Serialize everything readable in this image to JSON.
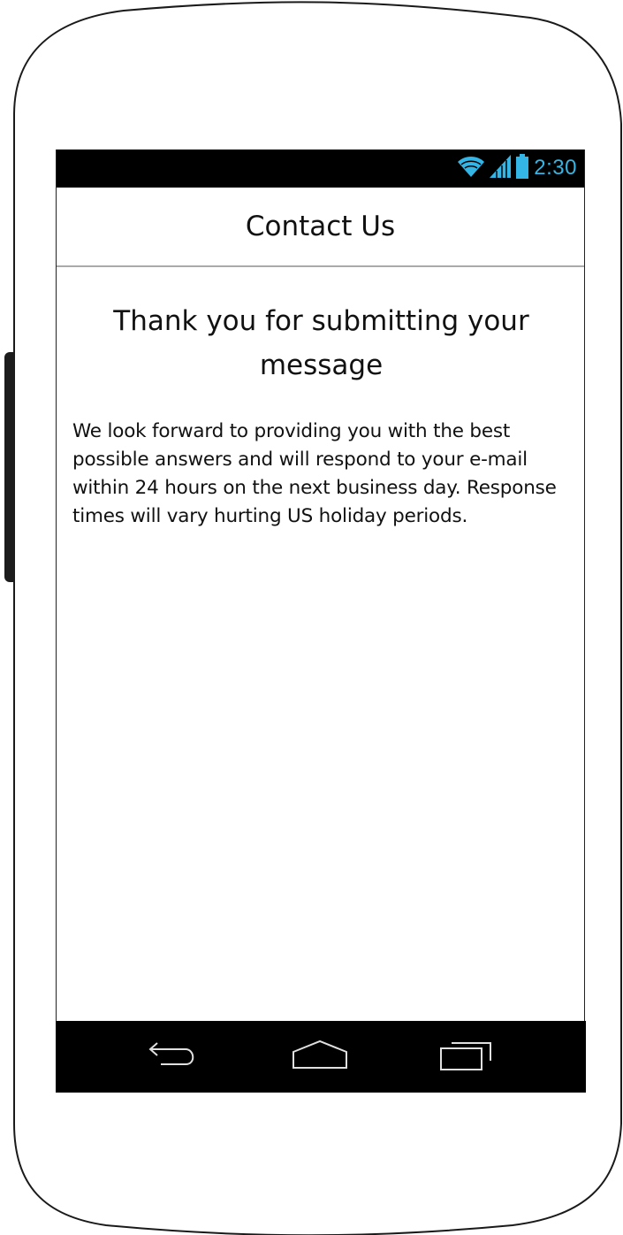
{
  "status_bar": {
    "time": "2:30",
    "icons": [
      "wifi-icon",
      "signal-icon",
      "battery-icon"
    ],
    "accent_color": "#33b5e5"
  },
  "header": {
    "title": "Contact Us"
  },
  "main": {
    "heading": "Thank you for submitting your message",
    "body": "We look forward to providing you with the best possible answers and will respond to your e-mail within 24 hours on the next business day. Response times will vary hurting US holiday periods."
  },
  "nav_bar": {
    "buttons": [
      "back-icon",
      "home-icon",
      "recent-apps-icon"
    ]
  }
}
